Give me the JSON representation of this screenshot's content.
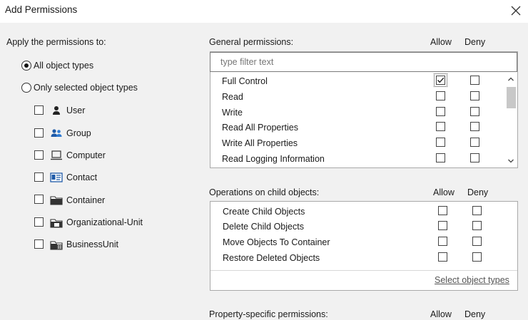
{
  "dialog": {
    "title": "Add Permissions"
  },
  "apply_to": {
    "label": "Apply the permissions to:",
    "options": [
      {
        "label": "All object types",
        "selected": true
      },
      {
        "label": "Only selected object types",
        "selected": false
      }
    ],
    "object_types": [
      {
        "label": "User",
        "icon": "user-icon",
        "checked": false
      },
      {
        "label": "Group",
        "icon": "group-icon",
        "checked": false
      },
      {
        "label": "Computer",
        "icon": "computer-icon",
        "checked": false
      },
      {
        "label": "Contact",
        "icon": "contact-icon",
        "checked": false
      },
      {
        "label": "Container",
        "icon": "folder-icon",
        "checked": false
      },
      {
        "label": "Organizational-Unit",
        "icon": "folder-icon",
        "checked": false
      },
      {
        "label": "BusinessUnit",
        "icon": "building-icon",
        "checked": false
      }
    ]
  },
  "general": {
    "label": "General permissions:",
    "allow_header": "Allow",
    "deny_header": "Deny",
    "filter_placeholder": "type filter text",
    "rows": [
      {
        "label": "Full Control",
        "allow": true,
        "deny": false
      },
      {
        "label": "Read",
        "allow": false,
        "deny": false
      },
      {
        "label": "Write",
        "allow": false,
        "deny": false
      },
      {
        "label": "Read All Properties",
        "allow": false,
        "deny": false
      },
      {
        "label": "Write All Properties",
        "allow": false,
        "deny": false
      },
      {
        "label": "Read Logging Information",
        "allow": false,
        "deny": false
      }
    ]
  },
  "child_ops": {
    "label": "Operations on child objects:",
    "allow_header": "Allow",
    "deny_header": "Deny",
    "rows": [
      {
        "label": "Create Child Objects",
        "allow": false,
        "deny": false
      },
      {
        "label": "Delete Child Objects",
        "allow": false,
        "deny": false
      },
      {
        "label": "Move Objects To Container",
        "allow": false,
        "deny": false
      },
      {
        "label": "Restore Deleted Objects",
        "allow": false,
        "deny": false
      }
    ],
    "link": "Select object types"
  },
  "property": {
    "label": "Property-specific permissions:",
    "allow_header": "Allow",
    "deny_header": "Deny"
  }
}
